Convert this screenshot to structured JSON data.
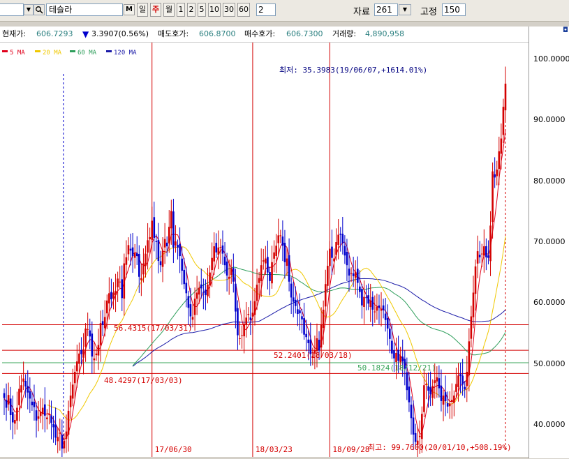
{
  "toolbar": {
    "stock_name": "테슬라",
    "m_button": "M",
    "period_buttons": [
      {
        "label": "일",
        "active": false
      },
      {
        "label": "주",
        "active": true
      },
      {
        "label": "월",
        "active": false
      },
      {
        "label": "1",
        "active": false
      },
      {
        "label": "2",
        "active": false
      },
      {
        "label": "5",
        "active": false
      },
      {
        "label": "10",
        "active": false
      },
      {
        "label": "30",
        "active": false
      },
      {
        "label": "60",
        "active": false
      }
    ],
    "period_input": "2",
    "data_label": "자료",
    "data_value": "261",
    "fixed_label": "고정",
    "fixed_value": "150"
  },
  "info": {
    "current_label": "현재가:",
    "current_value": "606.7293",
    "change_value": "3.3907(0.56%)",
    "ask_label": "매도호가:",
    "ask_value": "606.8700",
    "bid_label": "매수호가:",
    "bid_value": "606.7300",
    "volume_label": "거래량:",
    "volume_value": "4,890,958"
  },
  "colors": {
    "up": "#d40000",
    "down": "#0000cc",
    "ma5": "#e0001b",
    "ma20": "#f0c800",
    "ma60": "#2e9e5b",
    "ma120": "#1a1aa8"
  },
  "chart_data": {
    "type": "candlestick",
    "legend": [
      "5 MA",
      "20 MA",
      "60 MA",
      "120 MA"
    ],
    "yticks": [
      100.0,
      90.0,
      80.0,
      70.0,
      60.0,
      50.0,
      40.0
    ],
    "ytick_labels": [
      "100.0000",
      "90.0000",
      "80.0000",
      "70.0000",
      "60.0000",
      "50.0000",
      "40.0000"
    ],
    "ylim": [
      33.5,
      103.5
    ],
    "date_markers": [
      "17/06/30",
      "18/03/23",
      "18/09/28"
    ],
    "hlines": [
      {
        "value": 56.4315,
        "label": "56.4315(17/03/31)"
      },
      {
        "value": 52.2401,
        "label": "52.2401(18/03/18)"
      },
      {
        "value": 50.1824,
        "label": "50.1824(18/12/21)"
      },
      {
        "value": 48.4297,
        "label": "48.4297(17/03/03)"
      }
    ],
    "annotation_low": "최저: 35.3983(19/06/07,+1614.01%)",
    "annotation_high": "최고: 99.7600(20/01/10,+508.19%)",
    "closes": [
      44.4,
      42.8,
      44.9,
      41.6,
      40.4,
      40.8,
      42.8,
      45.9,
      46.5,
      47.6,
      46.3,
      45.3,
      44.3,
      43.2,
      42.9,
      40.7,
      41.4,
      42.1,
      42.8,
      41.5,
      41.2,
      41.7,
      40.3,
      39.6,
      37.9,
      38.0,
      38.7,
      36.1,
      37.4,
      38.9,
      42.3,
      44.8,
      46.6,
      48.7,
      50.4,
      51.7,
      51.6,
      52.4,
      55.8,
      55.7,
      54.5,
      51.2,
      50.9,
      51.7,
      53.1,
      56.7,
      56.4,
      57.7,
      60.4,
      61.6,
      60.6,
      61.7,
      62.0,
      64.0,
      63.5,
      60.8,
      66.5,
      67.5,
      69.5,
      68.6,
      67.7,
      68.2,
      67.7,
      64.3,
      64.1,
      66.5,
      68.1,
      70.3,
      70.8,
      73.5,
      70.7,
      70.0,
      66.9,
      66.2,
      68.6,
      70.5,
      69.3,
      72.5,
      75.1,
      69.1,
      70.1,
      69.1,
      67.7,
      65.3,
      63.1,
      61.6,
      59.2,
      57.8,
      57.7,
      60.7,
      61.7,
      62.5,
      62.4,
      61.7,
      61.3,
      63.0,
      65.0,
      67.4,
      69.3,
      68.3,
      69.1,
      69.2,
      68.1,
      66.2,
      64.5,
      64.3,
      65.7,
      63.5,
      58.6,
      54.7,
      54.2,
      54.7,
      56.6,
      57.6,
      58.2,
      57.2,
      58.4,
      60.3,
      63.0,
      64.1,
      66.2,
      67.0,
      67.3,
      65.0,
      63.6,
      66.7,
      68.3,
      69.4,
      71.1,
      71.1,
      69.4,
      66.7,
      67.3,
      63.5,
      60.9,
      60.2,
      59.5,
      58.2,
      58.3,
      57.3,
      54.8,
      54.4,
      53.4,
      51.6,
      51.3,
      52.2,
      54.2,
      52.2,
      56.5,
      58.9,
      63.1,
      66.1,
      68.9,
      67.4,
      67.3,
      70.0,
      71.2,
      71.2,
      69.8,
      67.8,
      66.2,
      64.5,
      64.9,
      64.4,
      65.1,
      63.3,
      61.8,
      59.6,
      61.0,
      60.9,
      59.9,
      60.4,
      58.9,
      58.6,
      59.4,
      59.2,
      59.0,
      58.8,
      57.2,
      55.8,
      54.1,
      51.7,
      50.9,
      51.8,
      50.5,
      51.3,
      50.4,
      49.2,
      45.7,
      43.7,
      41.1,
      38.4,
      37.2,
      37.4,
      38.2,
      41.8,
      46.5,
      46.7,
      45.6,
      45.0,
      46.4,
      47.3,
      47.8,
      46.0,
      43.9,
      44.8,
      43.9,
      43.0,
      43.5,
      44.1,
      44.8,
      46.7,
      48.1,
      48.0,
      46.6,
      45.8,
      48.7,
      53.7,
      57.8,
      61.7,
      66.0,
      68.5,
      67.5,
      68.1,
      69.3,
      67.5,
      67.4,
      72.7,
      81.6,
      80.6,
      81.9,
      84.9,
      87.0,
      92.2,
      96.0
    ]
  }
}
